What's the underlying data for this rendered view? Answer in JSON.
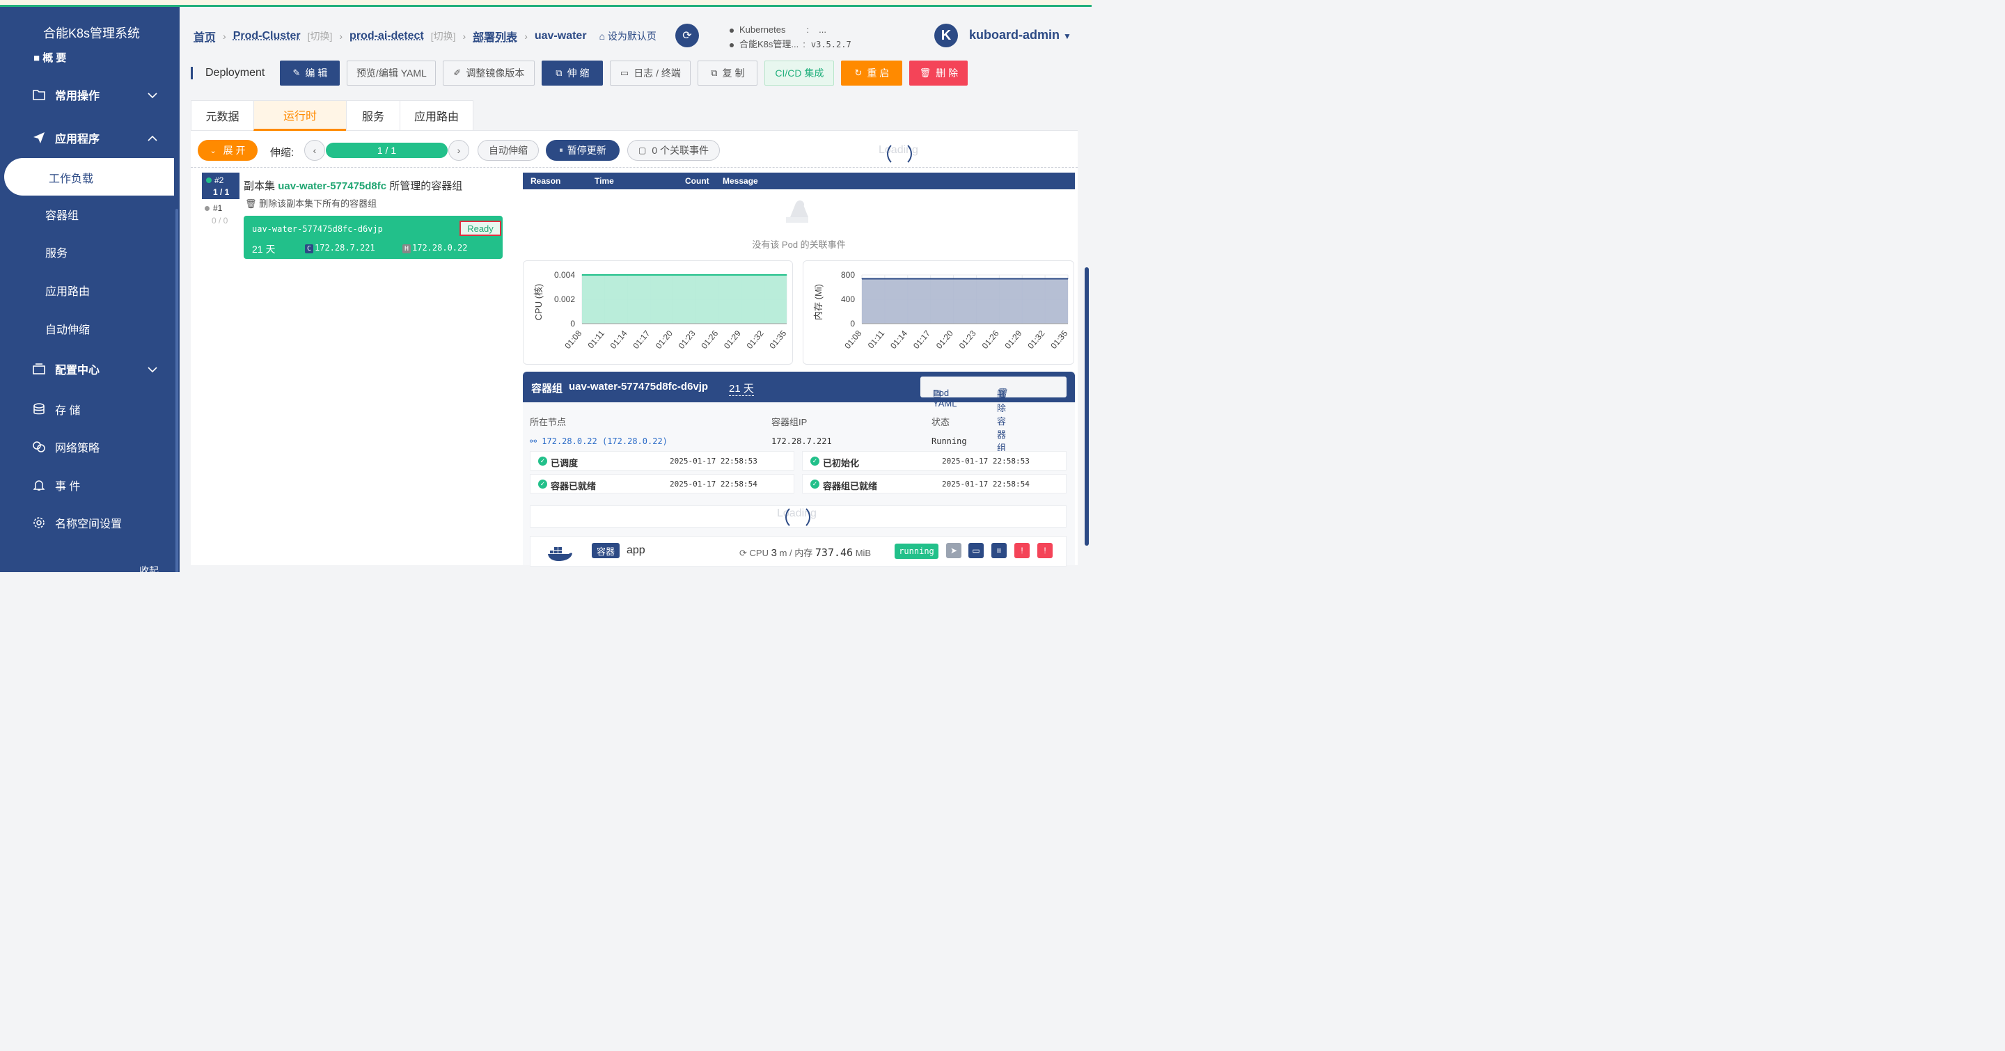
{
  "sidebar": {
    "title": "合能K8s管理系统",
    "cut_item": "■ 概 要",
    "groups": {
      "ops": "常用操作",
      "apps": "应用程序",
      "config": "配置中心"
    },
    "items": {
      "workload": "工作负载",
      "pods": "容器组",
      "service": "服务",
      "ingress": "应用路由",
      "hpa": "自动伸缩",
      "storage": "存 储",
      "netpol": "网络策略",
      "events": "事 件",
      "ns": "名称空间设置"
    },
    "collapse": "收起"
  },
  "header": {
    "crumb_home": "首页",
    "crumb_cluster": "Prod-Cluster",
    "crumb_switch": "[切换]",
    "crumb_ns": "prod-ai-detect",
    "crumb_deploys": "部署列表",
    "crumb_current": "uav-water",
    "set_default": "设为默认页",
    "k8s_label": "Kubernetes",
    "k8s_colon": ":",
    "k8s_val": "...",
    "sys_label": "合能K8s管理...",
    "sys_colon": ":",
    "sys_ver": "v3.5.2.7",
    "avatar": "K",
    "user": "kuboard-admin"
  },
  "toolbar": {
    "kind": "Deployment",
    "edit": "编 辑",
    "yaml": "预览/编辑 YAML",
    "image": "调整镜像版本",
    "scale": "伸 缩",
    "logs": "日志 / 终端",
    "copy": "复 制",
    "cicd": "CI/CD 集成",
    "restart": "重 启",
    "delete": "删 除"
  },
  "tabs": {
    "meta": "元数据",
    "runtime": "运行时",
    "svc": "服务",
    "route": "应用路由"
  },
  "controls": {
    "expand": "展 开",
    "scale_label": "伸缩:",
    "scale_value": "1 / 1",
    "auto": "自动伸缩",
    "pause": "暂停更新",
    "events": "0 个关联事件",
    "loading": "Loading"
  },
  "replicaset": {
    "badge_num": "#2",
    "badge_ready": "1 / 1",
    "title_prefix": "副本集",
    "name": "uav-water-577475d8fc",
    "title_suffix": "所管理的容器组",
    "delete_all": "删除该副本集下所有的容器组",
    "old_num": "#1",
    "old_ready": "0 / 0"
  },
  "pod": {
    "name": "uav-water-577475d8fc-d6vjp",
    "status": "Ready",
    "age": "21 天",
    "c_tag": "C",
    "container_ip": "172.28.7.221",
    "h_tag": "H",
    "host_ip": "172.28.0.22"
  },
  "events": {
    "cols": {
      "reason": "Reason",
      "time": "Time",
      "count": "Count",
      "message": "Message"
    },
    "empty": "没有该 Pod 的关联事件"
  },
  "colors": {
    "primary": "#2c4a85",
    "green": "#22c08a",
    "orange": "#ff8a00",
    "red": "#f44458"
  },
  "chart_data": [
    {
      "type": "area",
      "ylabel": "CPU (核)",
      "x": [
        "01:08",
        "01:11",
        "01:14",
        "01:17",
        "01:20",
        "01:23",
        "01:26",
        "01:29",
        "01:32",
        "01:35"
      ],
      "yticks": [
        "0.004",
        "0.002",
        "0"
      ],
      "ylim": [
        0,
        0.004
      ],
      "series": [
        {
          "values": [
            0.004,
            0.004,
            0.004,
            0.004,
            0.004,
            0.004,
            0.004,
            0.004,
            0.004,
            0.004
          ],
          "color": "#22c08a"
        }
      ]
    },
    {
      "type": "area",
      "ylabel": "内存 (Mi)",
      "x": [
        "01:08",
        "01:11",
        "01:14",
        "01:17",
        "01:20",
        "01:23",
        "01:26",
        "01:29",
        "01:32",
        "01:35"
      ],
      "yticks": [
        "800",
        "400",
        "0"
      ],
      "ylim": [
        0,
        800
      ],
      "series": [
        {
          "values": [
            737,
            737,
            737,
            737,
            737,
            737,
            737,
            737,
            737,
            737
          ],
          "color": "#2c4a85"
        }
      ]
    }
  ],
  "pod_detail": {
    "label": "容器组",
    "name": "uav-water-577475d8fc-d6vjp",
    "age": "21 天",
    "yaml_btn": "Pod YAML",
    "delete_btn": "删除容器组",
    "col_node": "所在节点",
    "col_ip": "容器组IP",
    "col_status": "状态",
    "node": "172.28.0.22 (172.28.0.22)",
    "ip": "172.28.7.221",
    "status": "Running",
    "conditions": [
      {
        "label": "已调度",
        "time": "2025-01-17 22:58:53"
      },
      {
        "label": "已初始化",
        "time": "2025-01-17 22:58:53"
      },
      {
        "label": "容器已就绪",
        "time": "2025-01-17 22:58:54"
      },
      {
        "label": "容器组已就绪",
        "time": "2025-01-17 22:58:54"
      }
    ],
    "loading": "Loading",
    "container": {
      "tag": "容器",
      "name": "app",
      "cpu_label": "CPU",
      "cpu_val": "3",
      "cpu_unit": "m",
      "mem_label": "/ 内存",
      "mem_val": "737.46",
      "mem_unit": "MiB",
      "state": "running"
    }
  }
}
